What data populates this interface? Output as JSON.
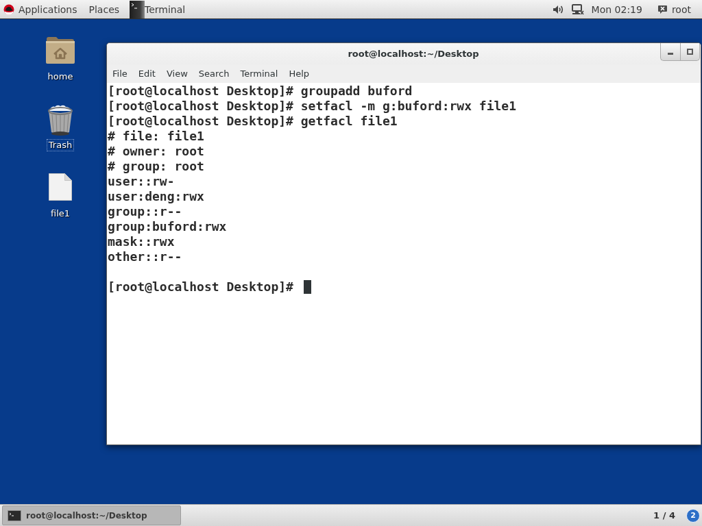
{
  "top_bar": {
    "applications_menu": "Applications",
    "places_menu": "Places",
    "app_menu": "Terminal",
    "clock": "Mon 02:19",
    "user_menu": "root"
  },
  "desktop_icons": [
    {
      "kind": "home",
      "label": "home",
      "focused": false
    },
    {
      "kind": "trash",
      "label": "Trash",
      "focused": true
    },
    {
      "kind": "file",
      "label": "file1",
      "focused": false
    }
  ],
  "terminal_window": {
    "title": "root@localhost:~/Desktop",
    "menu": [
      "File",
      "Edit",
      "View",
      "Search",
      "Terminal",
      "Help"
    ],
    "lines": [
      "[root@localhost Desktop]# groupadd buford",
      "[root@localhost Desktop]# setfacl -m g:buford:rwx file1",
      "[root@localhost Desktop]# getfacl file1",
      "# file: file1",
      "# owner: root",
      "# group: root",
      "user::rw-",
      "user:deng:rwx",
      "group::r--",
      "group:buford:rwx",
      "mask::rwx",
      "other::r--"
    ],
    "prompt": "[root@localhost Desktop]#",
    "cursor": true
  },
  "taskbar": {
    "windows": [
      {
        "label": "root@localhost:~/Desktop",
        "selected": true
      }
    ],
    "workspace": "1 / 4",
    "notification_count": "2"
  }
}
